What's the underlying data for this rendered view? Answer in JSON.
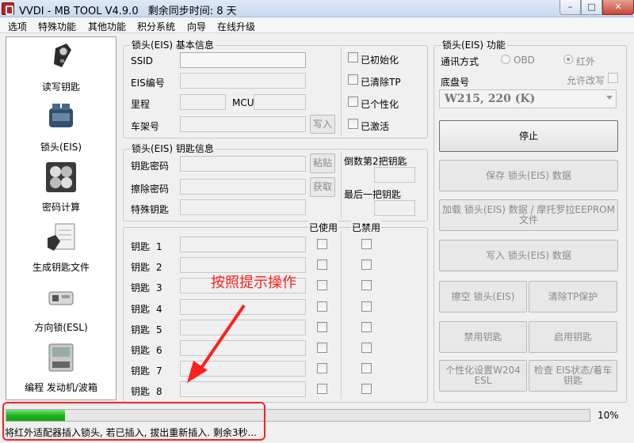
{
  "window": {
    "title": "VVDI - MB TOOL V4.9.0",
    "sync": "剩余同步时间: 8 天",
    "min": "–",
    "max": "□",
    "close": "✕"
  },
  "menu": [
    "选项",
    "特殊功能",
    "其他功能",
    "积分系统",
    "向导",
    "在线升级"
  ],
  "nav": [
    {
      "label": "读写钥匙",
      "icon": "car-key-icon"
    },
    {
      "label": "锁头(EIS)",
      "icon": "eis-module-icon"
    },
    {
      "label": "密码计算",
      "icon": "password-calc-icon"
    },
    {
      "label": "生成钥匙文件",
      "icon": "key-file-icon"
    },
    {
      "label": "方向锁(ESL)",
      "icon": "esl-lock-icon"
    },
    {
      "label": "编程 发动机/波箱",
      "icon": "ecu-module-icon"
    }
  ],
  "basic": {
    "title": "锁头(EIS) 基本信息",
    "ssid": "SSID",
    "eis_no": "EIS编号",
    "mileage": "里程",
    "mcu": "MCU",
    "vin": "车架号",
    "write_btn": "写入",
    "checks": [
      "已初始化",
      "已清除TP",
      "已个性化",
      "已激活"
    ]
  },
  "keyinfo": {
    "title": "锁头(EIS) 钥匙信息",
    "key_pwd": "钥匙密码",
    "erase_pwd": "擦除密码",
    "special_key": "特殊钥匙",
    "paste_btn": "粘贴",
    "get_btn": "获取",
    "second_last": "倒数第2把钥匙",
    "last_key": "最后一把钥匙"
  },
  "keys": {
    "used": "已使用",
    "disabled": "已禁用",
    "prefix": "钥匙",
    "numbers": [
      "1",
      "2",
      "3",
      "4",
      "5",
      "6",
      "7",
      "8"
    ]
  },
  "func": {
    "title": "锁头(EIS) 功能",
    "comm_mode": "通讯方式",
    "obd": "OBD",
    "ir": "红外",
    "chassis": "底盘号",
    "allow_edit": "允许改写",
    "chassis_value": "W215, 220 (K)",
    "stop": "停止",
    "save": "保存 锁头(EIS) 数据",
    "load": "加载 锁头(EIS) 数据 / 摩托罗拉EEPROM 文件",
    "write": "写入 锁头(EIS) 数据",
    "erase": "擦空 锁头(EIS)",
    "clear_tp": "清除TP保护",
    "disable_key": "禁用钥匙",
    "enable_key": "启用钥匙",
    "personalize": "个性化设置W204 ESL",
    "check_status": "检查 EIS状态/着车钥匙"
  },
  "annotation": "按照提示操作",
  "progress": {
    "value": 10,
    "label": "10%"
  },
  "status": "将红外适配器插入锁头, 若已插入, 拔出重新插入. 剩余3秒..."
}
